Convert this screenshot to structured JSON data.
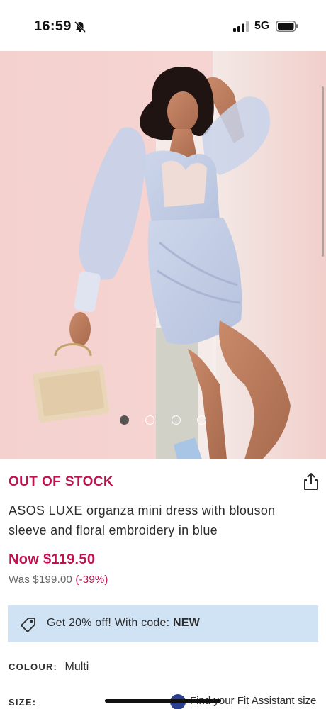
{
  "status_bar": {
    "time": "16:59",
    "network": "5G",
    "icons": [
      "bell-slash-icon",
      "signal-icon",
      "battery-icon"
    ]
  },
  "carousel": {
    "dot_count": 4,
    "active_index": 0
  },
  "product": {
    "stock_status": "OUT OF STOCK",
    "title": "ASOS LUXE organza mini dress with blouson sleeve and floral embroidery in blue",
    "price_now": "Now $119.50",
    "price_was_label": "Was $199.00",
    "price_discount": "(-39%)"
  },
  "promo": {
    "text": "Get 20% off! With code: ",
    "code": "NEW",
    "icon": "tag-icon"
  },
  "colour": {
    "label": "COLOUR:",
    "value": "Multi"
  },
  "size": {
    "label": "SIZE:",
    "fit_link": "Find your Fit Assistant size"
  },
  "colors": {
    "accent": "#c1114f",
    "promo_bg": "#cfe3f5"
  }
}
